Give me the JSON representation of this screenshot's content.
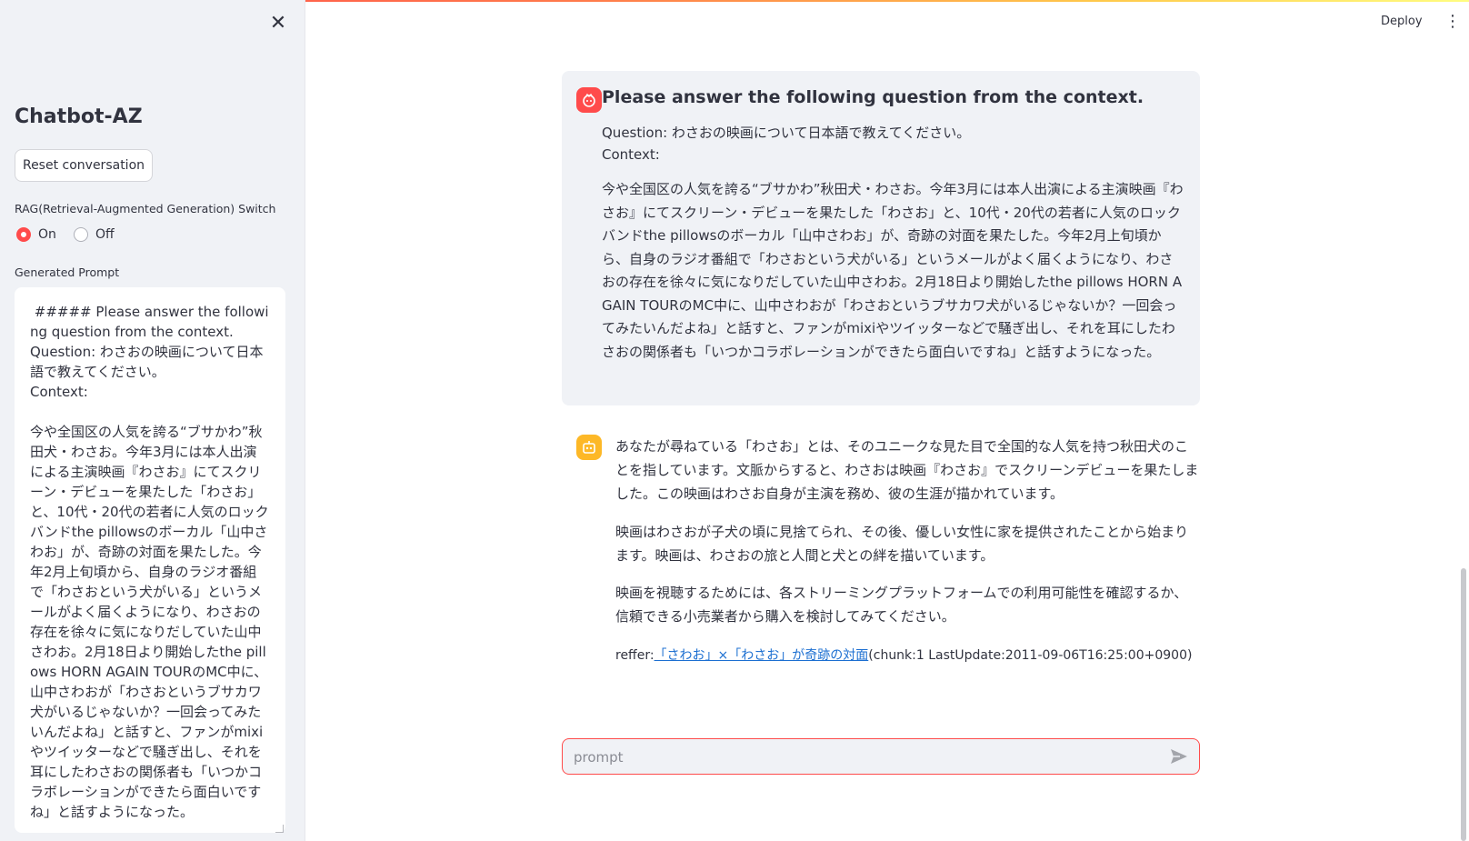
{
  "header": {
    "deploy_label": "Deploy",
    "menu_icon": "⋮"
  },
  "sidebar": {
    "close_icon": "✕",
    "title": "Chatbot-AZ",
    "reset_button": "Reset conversation",
    "rag_switch_label": "RAG(Retrieval-Augmented Generation) Switch",
    "rag_options": [
      {
        "label": "On",
        "selected": true
      },
      {
        "label": "Off",
        "selected": false
      }
    ],
    "generated_prompt_label": "Generated Prompt",
    "generated_prompt_text": " ##### Please answer the following question from the context.\nQuestion: わさおの映画について日本語で教えてください。\nContext:\n\n今や全国区の人気を誇る“ブサかわ”秋田犬・わさお。今年3月には本人出演による主演映画『わさお』にてスクリーン・デビューを果たした「わさお」と、10代・20代の若者に人気のロックバンドthe pillowsのボーカル「山中さわお」が、奇跡の対面を果たした。今年2月上旬頃から、自身のラジオ番組で「わさおという犬がいる」というメールがよく届くようになり、わさおの存在を徐々に気になりだしていた山中さわお。2月18日より開始したthe pillows HORN AGAIN TOURのMC中に、山中さわおが「わさおというブサカワ犬がいるじゃないか？一回会ってみたいんだよね」と話すと、ファンがmixiやツイッターなどで騒ぎ出し、それを耳にしたわさおの関係者も「いつかコラボレーションができたら面白いですね」と話すようになった。"
  },
  "chat": {
    "user_message": {
      "heading": "Please answer the following question from the context.",
      "question": "Question: わさおの映画について日本語で教えてください。",
      "context_label": "Context:",
      "context_text": "今や全国区の人気を誇る“ブサかわ”秋田犬・わさお。今年3月には本人出演による主演映画『わさお』にてスクリーン・デビューを果たした「わさお」と、10代・20代の若者に人気のロックバンドthe pillowsのボーカル「山中さわお」が、奇跡の対面を果たした。今年2月上旬頃から、自身のラジオ番組で「わさおという犬がいる」というメールがよく届くようになり、わさおの存在を徐々に気になりだしていた山中さわお。2月18日より開始したthe pillows HORN AGAIN TOURのMC中に、山中さわおが「わさおというブサカワ犬がいるじゃないか？一回会ってみたいんだよね」と話すと、ファンがmixiやツイッターなどで騒ぎ出し、それを耳にしたわさおの関係者も「いつかコラボレーションができたら面白いですね」と話すようになった。"
    },
    "assistant_message": {
      "paragraphs": [
        "あなたが尋ねている「わさお」とは、そのユニークな見た目で全国的な人気を持つ秋田犬のことを指しています。文脈からすると、わさおは映画『わさお』でスクリーンデビューを果たしました。この映画はわさお自身が主演を務め、彼の生涯が描かれています。",
        "映画はわさおが子犬の頃に見捨てられ、その後、優しい女性に家を提供されたことから始まります。映画は、わさおの旅と人間と犬との絆を描いています。",
        "映画を視聴するためには、各ストリーミングプラットフォームでの利用可能性を確認するか、信頼できる小売業者から購入を検討してみてください。"
      ],
      "refer_prefix": "reffer:",
      "refer_link": "「さわお」×「わさお」が奇跡の対面",
      "refer_suffix": "(chunk:1 LastUpdate:2011-09-06T16:25:00+0900)"
    },
    "input": {
      "placeholder": "prompt",
      "value": ""
    }
  },
  "colors": {
    "accent": "#ff4b4b",
    "bot_avatar": "#fdb827",
    "link": "#1c6fd1",
    "panel": "#f0f2f6"
  }
}
